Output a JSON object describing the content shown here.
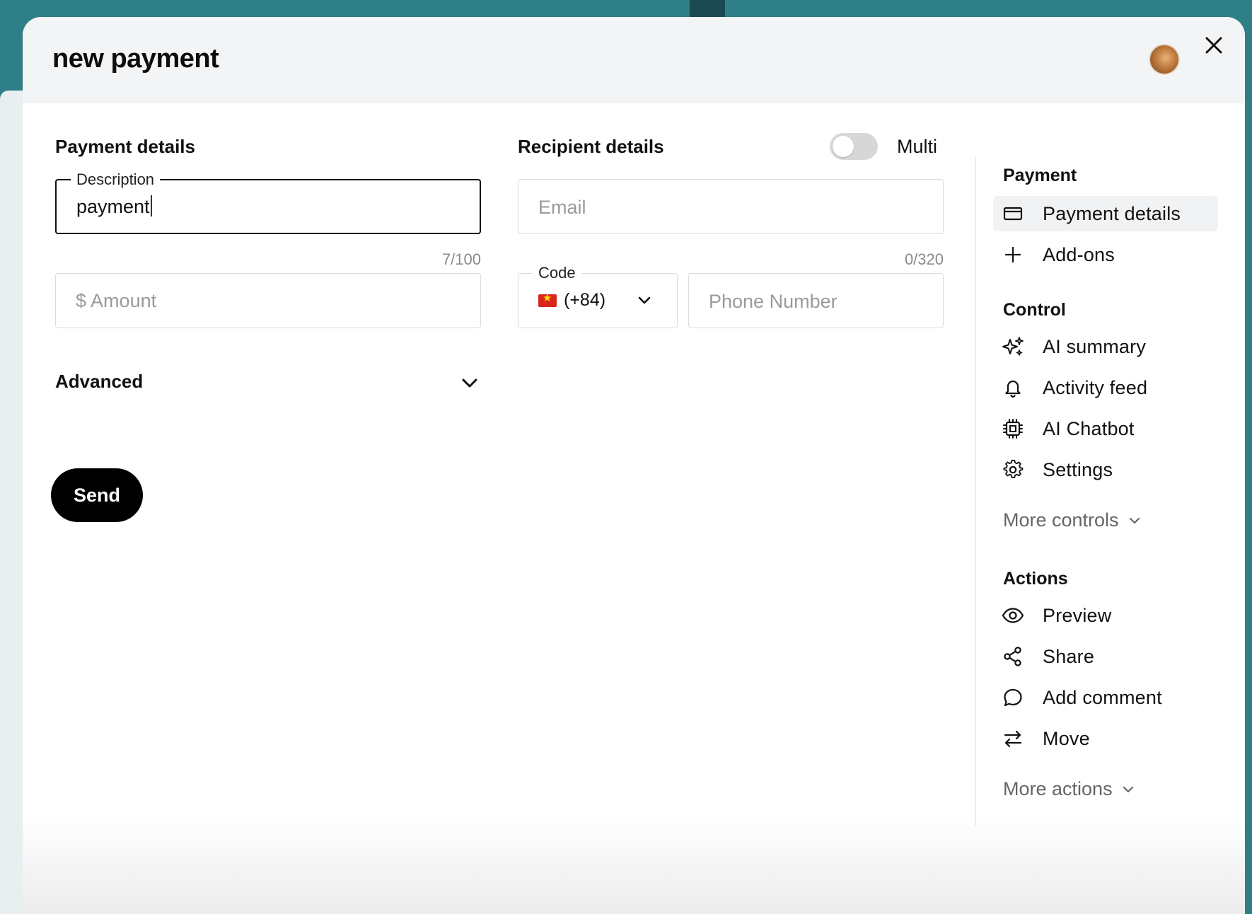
{
  "modal": {
    "title": "new payment"
  },
  "payment_details": {
    "heading": "Payment details",
    "description": {
      "legend": "Description",
      "value": "payment",
      "counter": "7/100"
    },
    "amount": {
      "prefix": "$",
      "placeholder": "Amount"
    },
    "advanced": {
      "label": "Advanced"
    },
    "send_label": "Send"
  },
  "recipient_details": {
    "heading": "Recipient details",
    "multi_toggle": {
      "label": "Multi",
      "on": false
    },
    "email": {
      "placeholder": "Email",
      "counter": "0/320"
    },
    "code": {
      "legend": "Code",
      "value": "(+84)",
      "flag": "vietnam-flag"
    },
    "phone": {
      "placeholder": "Phone Number"
    }
  },
  "sidebar": {
    "payment": {
      "heading": "Payment",
      "items": [
        {
          "label": "Payment details",
          "icon": "credit-card-icon",
          "selected": true
        },
        {
          "label": "Add-ons",
          "icon": "plus-icon"
        }
      ]
    },
    "control": {
      "heading": "Control",
      "items": [
        {
          "label": "AI summary",
          "icon": "sparkles-icon"
        },
        {
          "label": "Activity feed",
          "icon": "bell-icon"
        },
        {
          "label": "AI Chatbot",
          "icon": "chip-icon"
        },
        {
          "label": "Settings",
          "icon": "gear-icon"
        }
      ],
      "more_label": "More controls"
    },
    "actions": {
      "heading": "Actions",
      "items": [
        {
          "label": "Preview",
          "icon": "eye-icon"
        },
        {
          "label": "Share",
          "icon": "share-icon"
        },
        {
          "label": "Add comment",
          "icon": "comment-icon"
        },
        {
          "label": "Move",
          "icon": "arrows-swap-icon"
        }
      ],
      "more_label": "More actions"
    }
  }
}
